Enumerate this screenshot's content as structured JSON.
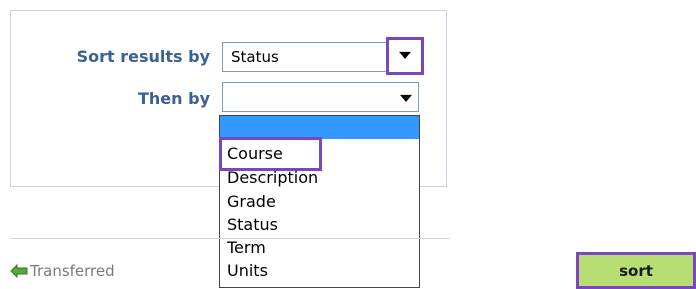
{
  "sort_panel": {
    "sort_label": "Sort results by",
    "then_label": "Then by",
    "sort_select": {
      "value": "Status"
    },
    "then_select": {
      "value": "",
      "options": [
        "",
        "Course",
        "Description",
        "Grade",
        "Status",
        "Term",
        "Units"
      ]
    }
  },
  "legend": {
    "transferred_label": "Transferred",
    "transferred_icon": "left-arrow-icon",
    "transferred_icon_color": "#5ba63b"
  },
  "actions": {
    "sort_label": "sort"
  },
  "colors": {
    "label_color": "#3a6193",
    "highlight_color": "#7d46c1",
    "selected_option_bg": "#3399ff",
    "sort_button_bg": "#b6de73"
  }
}
